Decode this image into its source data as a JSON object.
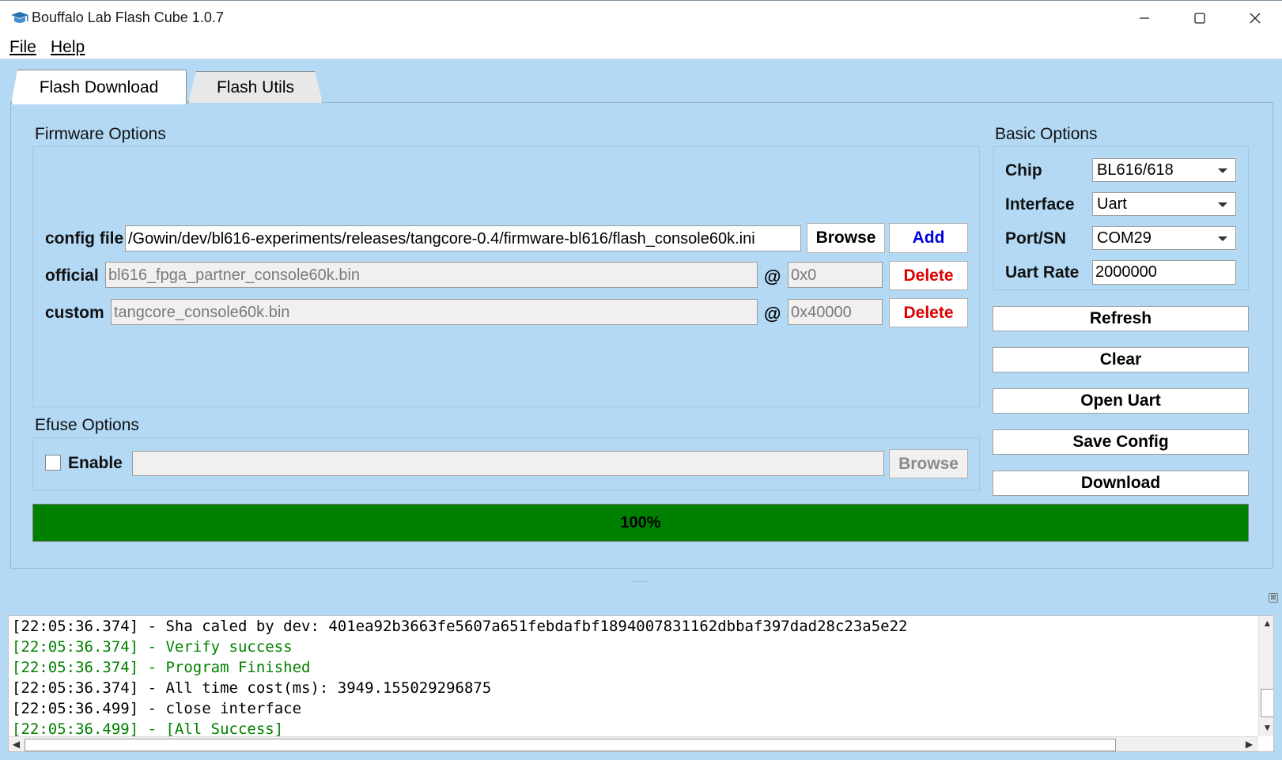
{
  "window": {
    "title": "Bouffalo Lab Flash Cube 1.0.7",
    "accent_bg": "#b3d9f5"
  },
  "menu": {
    "file_label": "File",
    "help_label": "Help"
  },
  "tabs": [
    {
      "label": "Flash Download",
      "active": true
    },
    {
      "label": "Flash Utils",
      "active": false
    }
  ],
  "firmware": {
    "section_title": "Firmware Options",
    "config_label": "config file",
    "config_value": "/Gowin/dev/bl616-experiments/releases/tangcore-0.4/firmware-bl616/flash_console60k.ini",
    "browse_label": "Browse",
    "add_label": "Add",
    "rows": [
      {
        "label": "official",
        "file": "bl616_fpga_partner_console60k.bin",
        "at": "@",
        "address": "0x0",
        "delete_label": "Delete"
      },
      {
        "label": "custom",
        "file": "tangcore_console60k.bin",
        "at": "@",
        "address": "0x40000",
        "delete_label": "Delete"
      }
    ]
  },
  "efuse": {
    "section_title": "Efuse Options",
    "enable_label": "Enable",
    "enabled": false,
    "path_value": "",
    "browse_label": "Browse"
  },
  "basic": {
    "section_title": "Basic Options",
    "chip_label": "Chip",
    "chip_value": "BL616/618",
    "interface_label": "Interface",
    "interface_value": "Uart",
    "port_label": "Port/SN",
    "port_value": "COM29",
    "rate_label": "Uart Rate",
    "rate_value": "2000000"
  },
  "actions": {
    "refresh": "Refresh",
    "clear": "Clear",
    "open_uart": "Open Uart",
    "save_config": "Save Config",
    "download": "Download"
  },
  "progress": {
    "value": 1.0,
    "text": "100%",
    "color": "#008000"
  },
  "log": {
    "lines": [
      {
        "text": "[22:05:36.374] - Sha caled by dev: 401ea92b3663fe5607a651febdafbf1894007831162dbbaf397dad28c23a5e22",
        "color": "#000000"
      },
      {
        "text": "[22:05:36.374] - Verify success",
        "color": "#008000"
      },
      {
        "text": "[22:05:36.374] - Program Finished",
        "color": "#008000"
      },
      {
        "text": "[22:05:36.374] - All time cost(ms): 3949.155029296875",
        "color": "#000000"
      },
      {
        "text": "[22:05:36.499] - close interface",
        "color": "#000000"
      },
      {
        "text": "[22:05:36.499] - [All Success]",
        "color": "#008000"
      }
    ]
  }
}
